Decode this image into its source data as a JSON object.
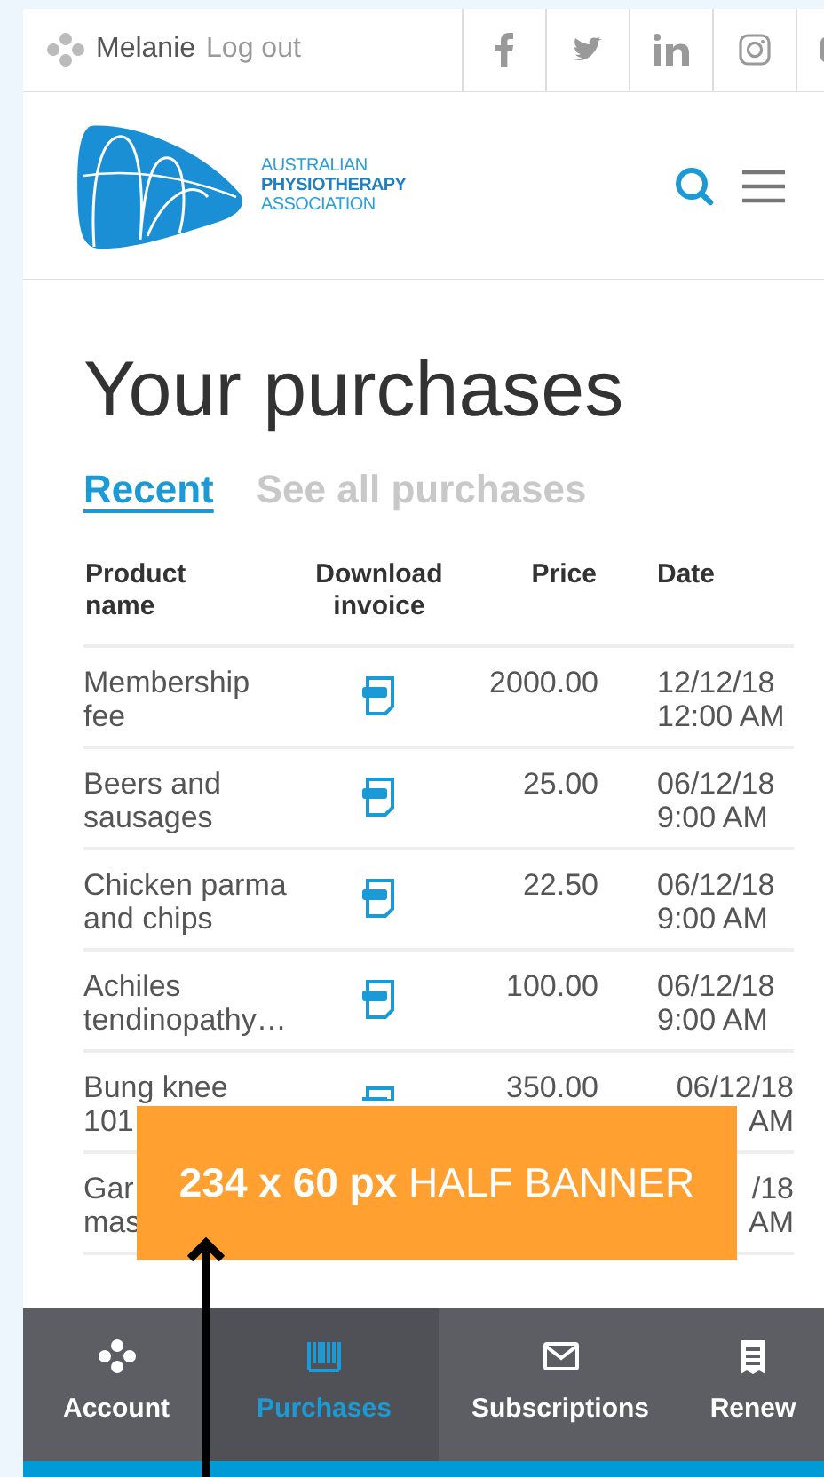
{
  "top_bar": {
    "user_name": "Melanie",
    "logout": "Log out"
  },
  "logo": {
    "lines": [
      "AUSTRALIAN",
      "PHYSIOTHERAPY",
      "ASSOCIATION"
    ]
  },
  "title": "Your purchases",
  "tabs": [
    {
      "label": "Recent",
      "selected": true
    },
    {
      "label": "See all purchases",
      "selected": false
    }
  ],
  "table": {
    "columns": [
      "Product name",
      "Download invoice",
      "Price",
      "Date"
    ],
    "rows": [
      {
        "name": "Membership\nfee",
        "invoice": true,
        "price": "2000.00",
        "date": "12/12/18\n12:00 AM",
        "covered": false
      },
      {
        "name": "Beers and\nsausages",
        "invoice": true,
        "price": "25.00",
        "date": "06/12/18\n9:00 AM",
        "covered": false
      },
      {
        "name": "Chicken parma\nand chips",
        "invoice": true,
        "price": "22.50",
        "date": "06/12/18\n9:00 AM",
        "covered": false
      },
      {
        "name": "Achiles\ntendinopathy…",
        "invoice": true,
        "price": "100.00",
        "date": "06/12/18\n9:00 AM",
        "covered": false
      },
      {
        "name": "Bung knee\n101",
        "invoice": true,
        "price": "350.00",
        "date": "06/12/18\nAM",
        "covered": true
      },
      {
        "name": "Gar\nmas",
        "invoice": false,
        "date": "/18\nAM",
        "covered": true
      }
    ]
  },
  "banner": {
    "text": "**234 x 60 px** HALF BANNER"
  },
  "bottom_nav": [
    {
      "label": "Account",
      "selected": false
    },
    {
      "label": "Purchases",
      "selected": true
    },
    {
      "label": "Subscriptions",
      "selected": false
    },
    {
      "label": "Renew",
      "selected": false
    }
  ]
}
